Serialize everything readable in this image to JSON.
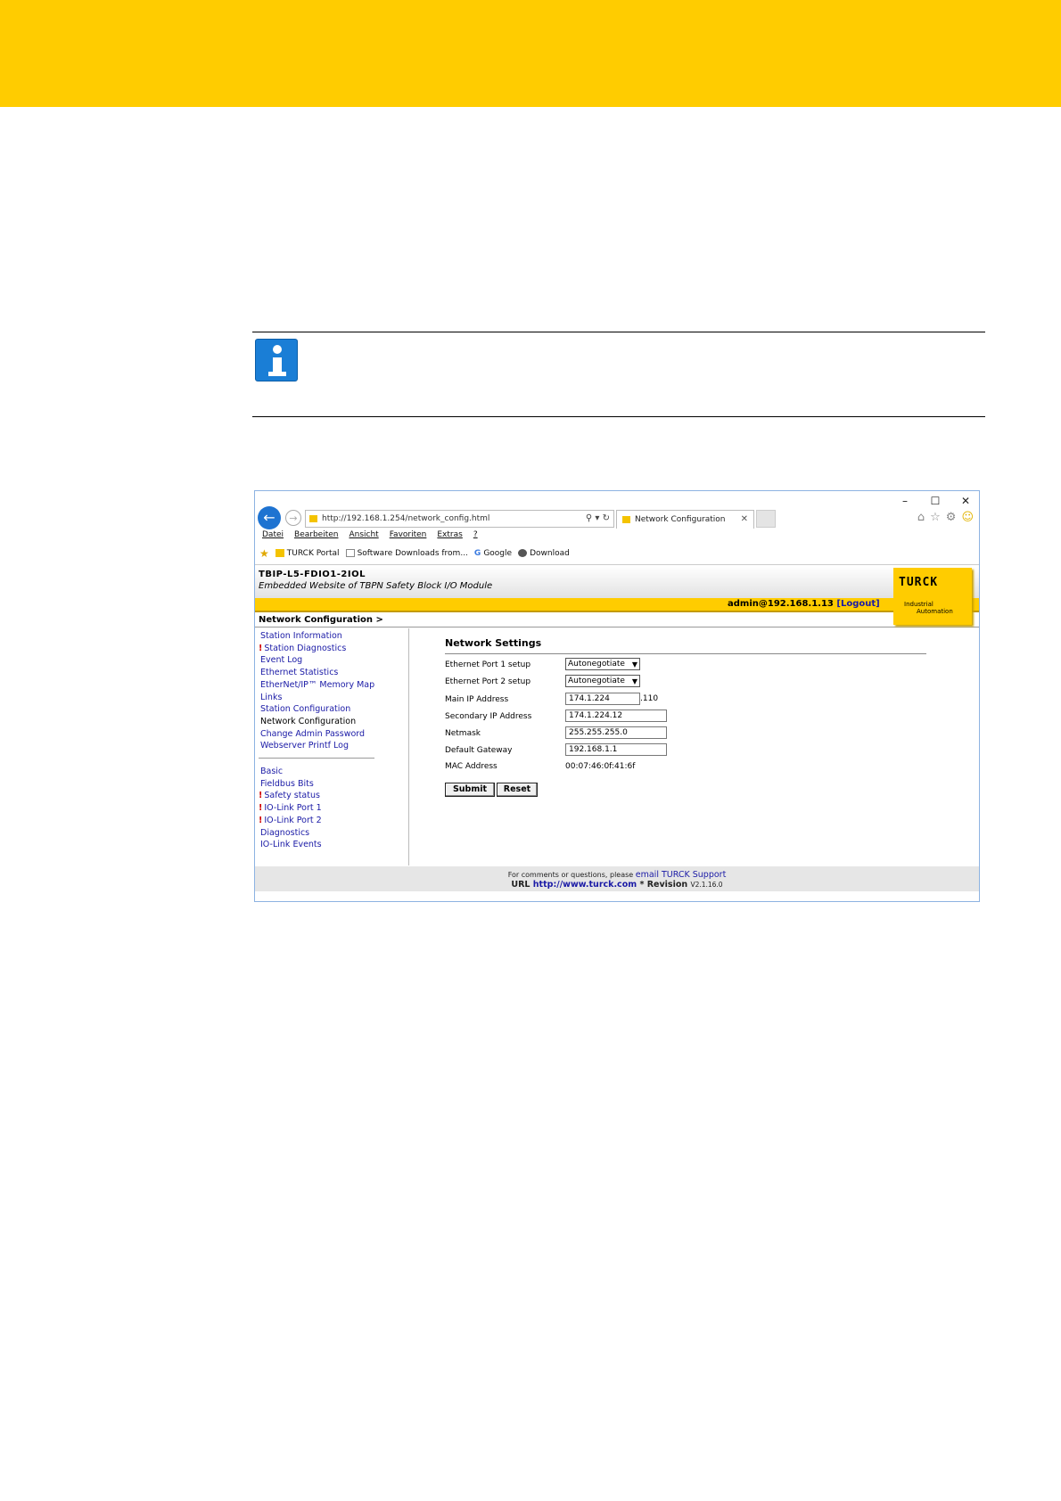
{
  "colors": {
    "brand_yellow": "#ffcc00",
    "link_blue": "#1a1aa6",
    "warning_red": "#d10000",
    "info_blue": "#1a7ed6"
  },
  "browser": {
    "url": "http://192.168.1.254/network_config.html",
    "tab_title": "Network Configuration",
    "window_controls": [
      "–",
      "☐",
      "✕"
    ],
    "menu": [
      "Datei",
      "Bearbeiten",
      "Ansicht",
      "Favoriten",
      "Extras",
      "?"
    ],
    "favorites": [
      "TURCK Portal",
      "Software Downloads from...",
      "Google",
      "Download"
    ]
  },
  "site": {
    "device_title": "TBIP-L5-FDIO1-2IOL",
    "device_subtitle": "Embedded Website of TBPN Safety Block I/O Module",
    "logo": {
      "text": "TURCK",
      "sub1": "Industrial",
      "sub2": "Automation"
    },
    "user": "admin@192.168.1.13",
    "logout_label": "[Logout]",
    "breadcrumb": "Network Configuration >",
    "nav_group1": [
      {
        "label": "Station Information",
        "warn": ""
      },
      {
        "label": "Station Diagnostics",
        "warn": "!"
      },
      {
        "label": "Event Log",
        "warn": ""
      },
      {
        "label": "Ethernet Statistics",
        "warn": ""
      },
      {
        "label": "EtherNet/IP™ Memory Map",
        "warn": ""
      },
      {
        "label": "Links",
        "warn": ""
      },
      {
        "label": "Station Configuration",
        "warn": ""
      },
      {
        "label": "Network Configuration",
        "warn": ""
      },
      {
        "label": "Change Admin Password",
        "warn": ""
      },
      {
        "label": "Webserver Printf Log",
        "warn": ""
      }
    ],
    "nav_group2": [
      {
        "label": "Basic",
        "warn": ""
      },
      {
        "label": "Fieldbus Bits",
        "warn": ""
      },
      {
        "label": "Safety status",
        "warn": "!"
      },
      {
        "label": "IO-Link Port 1",
        "warn": "!"
      },
      {
        "label": "IO-Link Port 2",
        "warn": "!"
      },
      {
        "label": "Diagnostics",
        "warn": ""
      },
      {
        "label": "IO-Link Events",
        "warn": ""
      }
    ],
    "network_settings": {
      "title": "Network Settings",
      "port1_label": "Ethernet Port 1 setup",
      "port1_value": "Autonegotiate",
      "port2_label": "Ethernet Port 2 setup",
      "port2_value": "Autonegotiate",
      "main_ip_label": "Main IP Address",
      "main_ip_value": "174.1.224",
      "main_ip_suffix": ".110",
      "secondary_ip_label": "Secondary IP Address",
      "secondary_ip_value": "174.1.224.12",
      "netmask_label": "Netmask",
      "netmask_value": "255.255.255.0",
      "gateway_label": "Default Gateway",
      "gateway_value": "192.168.1.1",
      "mac_label": "MAC Address",
      "mac_value": "00:07:46:0f:41:6f",
      "submit_label": "Submit",
      "reset_label": "Reset"
    },
    "footer": {
      "comment_text": "For comments or questions, please",
      "support_link": "email TURCK Support",
      "url_label": "URL",
      "url_link": "http://www.turck.com",
      "revision_label": "* Revision",
      "revision_value": "V2.1.16.0"
    }
  }
}
